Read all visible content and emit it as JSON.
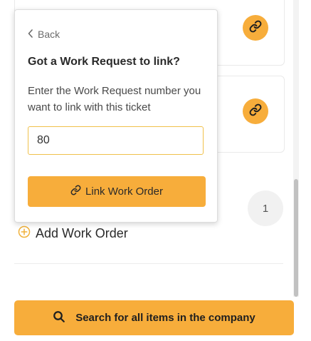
{
  "popover": {
    "back_label": "Back",
    "title": "Got a Work Request to link?",
    "description": "Enter the Work Request number you want to link with this ticket",
    "input_value": "80",
    "link_button_label": "Link Work Order"
  },
  "background": {
    "count_badge": "1",
    "add_work_order_label": "Add Work Order",
    "search_all_label": "Search for all items in the company"
  },
  "icons": {
    "back": "chevron-left-icon",
    "link": "link-icon",
    "add": "plus-circle-icon",
    "search": "search-icon"
  },
  "colors": {
    "accent": "#f7ad3b",
    "input_border": "#f0c14b",
    "badge_bg": "#f1f1f1"
  }
}
